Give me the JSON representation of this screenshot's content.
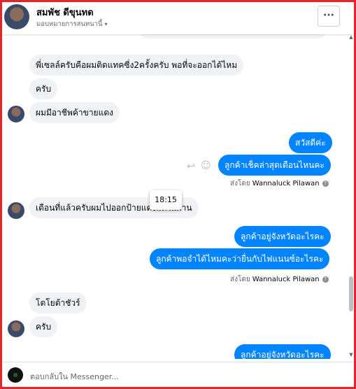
{
  "header": {
    "name": "สมพัช ดีขุนทด",
    "assign_label": "มอบหมายการสนทนานี้",
    "caret": "▾",
    "menu_label": "···"
  },
  "messages": {
    "m1": "พี่เซลล์ครับคือผมติดแทคซี่ง2ครั้งครับ พอที่จะออกได้ไหม",
    "m2": "ครับ",
    "m3": "ผมมีอาชีพค้าขายแดง",
    "m4": "สวัสดีค่ะ",
    "m5": "ลูกค้าเช็คล่าสุดเดือนไหนคะ",
    "m6": "เดือนที่แล้วครับผมไปออกป้ายแดงแต่ไม่ผ่าน",
    "m7": "ลูกค้าอยู่จังหวัดอะไรคะ",
    "m8": "ลูกค้าพอจำได้ไหมคะว่ายื่นกับไฟแนนซ์อะไรคะ",
    "m9": "โตโยต้าชัวร์",
    "m10": "ครับ",
    "m11": "ลูกค้าอยู่จังหวัดอะไรคะ"
  },
  "sent_by": {
    "prefix": "ส่งโดย",
    "agent": "Wannaluck Pilawan",
    "info": "?"
  },
  "time_chip": "18:15",
  "icons": {
    "reply": "↩",
    "emoji": "☺"
  },
  "composer": {
    "placeholder": "ตอบกลับใน Messenger..."
  },
  "colors": {
    "frame": "#e3262a",
    "outgoing": "#0084ff",
    "incoming": "#f0f2f5"
  }
}
